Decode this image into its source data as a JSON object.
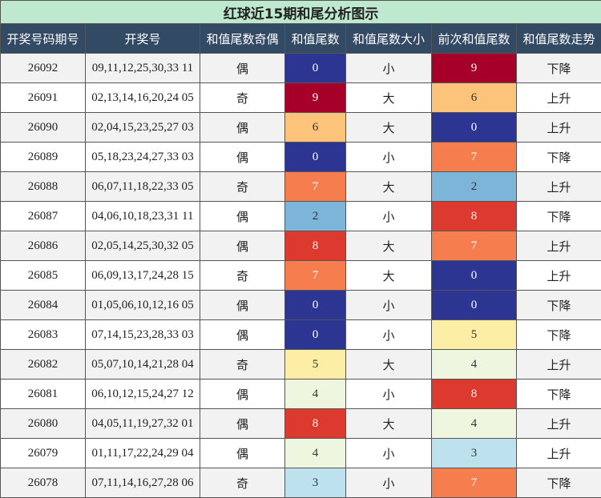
{
  "title": "红球近15期和尾分析图示",
  "headers": [
    "开奖号码期号",
    "开奖号",
    "和值尾数奇偶",
    "和值尾数",
    "和值尾数大小",
    "前次和值尾数",
    "和值尾数走势"
  ],
  "digit_colors": {
    "0": "#2c3592",
    "2": "#7db5d8",
    "3": "#bde2ee",
    "4": "#eef6df",
    "5": "#fdeea6",
    "6": "#fcc47a",
    "7": "#f57d4e",
    "8": "#dc3a2f",
    "9": "#a6002a"
  },
  "rows": [
    {
      "issue": "26092",
      "numbers": "09,11,12,25,30,33 11",
      "parity": "偶",
      "tail": "0",
      "size": "小",
      "prev_tail": "9",
      "trend": "下降"
    },
    {
      "issue": "26091",
      "numbers": "02,13,14,16,20,24 05",
      "parity": "奇",
      "tail": "9",
      "size": "大",
      "prev_tail": "6",
      "trend": "上升"
    },
    {
      "issue": "26090",
      "numbers": "02,04,15,23,25,27 03",
      "parity": "偶",
      "tail": "6",
      "size": "大",
      "prev_tail": "0",
      "trend": "上升"
    },
    {
      "issue": "26089",
      "numbers": "05,18,23,24,27,33 03",
      "parity": "偶",
      "tail": "0",
      "size": "小",
      "prev_tail": "7",
      "trend": "下降"
    },
    {
      "issue": "26088",
      "numbers": "06,07,11,18,22,33 05",
      "parity": "奇",
      "tail": "7",
      "size": "大",
      "prev_tail": "2",
      "trend": "上升"
    },
    {
      "issue": "26087",
      "numbers": "04,06,10,18,23,31 11",
      "parity": "偶",
      "tail": "2",
      "size": "小",
      "prev_tail": "8",
      "trend": "下降"
    },
    {
      "issue": "26086",
      "numbers": "02,05,14,25,30,32 05",
      "parity": "偶",
      "tail": "8",
      "size": "大",
      "prev_tail": "7",
      "trend": "上升"
    },
    {
      "issue": "26085",
      "numbers": "06,09,13,17,24,28 15",
      "parity": "奇",
      "tail": "7",
      "size": "大",
      "prev_tail": "0",
      "trend": "上升"
    },
    {
      "issue": "26084",
      "numbers": "01,05,06,10,12,16 05",
      "parity": "偶",
      "tail": "0",
      "size": "小",
      "prev_tail": "0",
      "trend": "下降"
    },
    {
      "issue": "26083",
      "numbers": "07,14,15,23,28,33 03",
      "parity": "偶",
      "tail": "0",
      "size": "小",
      "prev_tail": "5",
      "trend": "下降"
    },
    {
      "issue": "26082",
      "numbers": "05,07,10,14,21,28 04",
      "parity": "奇",
      "tail": "5",
      "size": "大",
      "prev_tail": "4",
      "trend": "上升"
    },
    {
      "issue": "26081",
      "numbers": "06,10,12,15,24,27 12",
      "parity": "偶",
      "tail": "4",
      "size": "小",
      "prev_tail": "8",
      "trend": "下降"
    },
    {
      "issue": "26080",
      "numbers": "04,05,11,19,27,32 01",
      "parity": "偶",
      "tail": "8",
      "size": "大",
      "prev_tail": "4",
      "trend": "上升"
    },
    {
      "issue": "26079",
      "numbers": "01,11,17,22,24,29 04",
      "parity": "偶",
      "tail": "4",
      "size": "小",
      "prev_tail": "3",
      "trend": "上升"
    },
    {
      "issue": "26078",
      "numbers": "07,11,14,16,27,28 06",
      "parity": "奇",
      "tail": "3",
      "size": "小",
      "prev_tail": "7",
      "trend": "下降"
    }
  ]
}
